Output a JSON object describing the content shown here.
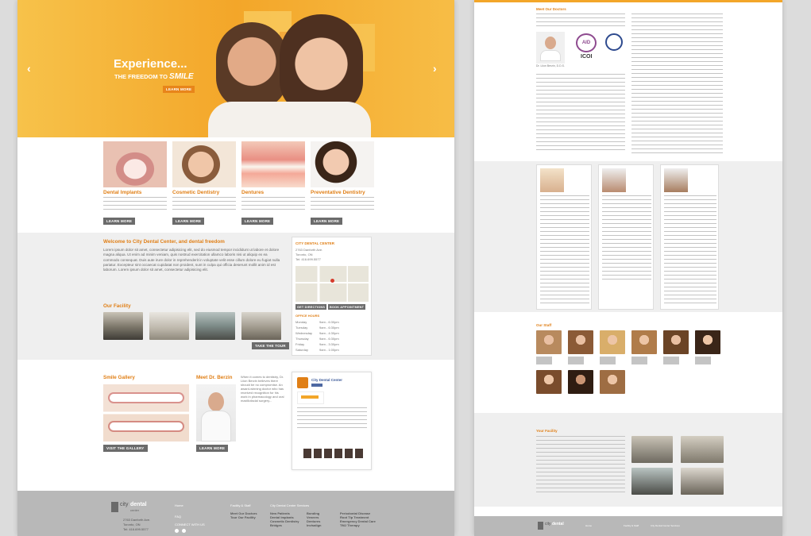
{
  "hero": {
    "title": "Experience...",
    "subtitle_prefix": "THE FREEDOM TO",
    "subtitle_emphasis": "SMILE",
    "button": "LEARN MORE"
  },
  "services": [
    {
      "title": "Dental Implants",
      "button": "LEARN MORE"
    },
    {
      "title": "Cosmetic Dentistry",
      "button": "LEARN MORE"
    },
    {
      "title": "Dentures",
      "button": "LEARN MORE"
    },
    {
      "title": "Preventative Dentistry",
      "button": "LEARN MORE"
    }
  ],
  "welcome": {
    "title": "Welcome to City Dental Center, and dental freedom",
    "body": "Lorem ipsum dolor sit amet, consectetur adipisicing elit, sed do eiusmod tempor incididunt ut labore et dolore magna aliqua. Ut enim ad minim veniam, quis nostrud exercitation ullamco laboris nisi ut aliquip ex ea commodo consequat. Duis aute irure dolor in reprehenderit in voluptate velit esse cillum dolore eu fugiat nulla pariatur. Excepteur sint occaecat cupidatat non proident, sunt in culpa qui officia deserunt mollit anim id est laborum. Lorem ipsum dolor sit amet, consectetur adipisicing elit."
  },
  "facility": {
    "title": "Our Facility",
    "button": "TAKE THE TOUR"
  },
  "contact": {
    "name": "CITY DENTAL CENTER",
    "address1": "2763 Danforth Ave.",
    "address2": "Toronto, ON",
    "phone": "Tel: 416.699.5577",
    "directions_button": "GET DIRECTIONS",
    "appointment_button": "BOOK APPOINTMENT",
    "hours_title": "OFFICE HOURS",
    "hours": [
      {
        "day": "Monday",
        "time": "9am - 6:30pm"
      },
      {
        "day": "Tuesday",
        "time": "9am - 6:30pm"
      },
      {
        "day": "Wednesday",
        "time": "9am - 4:30pm"
      },
      {
        "day": "Thursday",
        "time": "9am - 6:30pm"
      },
      {
        "day": "Friday",
        "time": "9am - 3:30pm"
      },
      {
        "day": "Saturday",
        "time": "9am - 1:00pm"
      }
    ]
  },
  "gallery": {
    "title": "Smile Gallery",
    "button": "VISIT THE GALLERY"
  },
  "meet": {
    "title": "Meet Dr. Berzin",
    "body": "When it comes to dentistry, Dr. Liion Berzin believes there should be no compromise. An award-winning doctor who has received recognition for his work in pharmacology and oral maxillofacial surgery...",
    "button": "LEARN MORE"
  },
  "social": {
    "name": "City Dental Center"
  },
  "footer": {
    "logo_city": "city",
    "logo_dental": "dental",
    "logo_center": "center",
    "addr1": "2763 Danforth Ave.",
    "addr2": "Toronto, ON",
    "phone": "Tel: 416.699.5577",
    "col1": [
      "Home",
      "FAQ",
      "CONNECT WITH US"
    ],
    "col2_title": "Facility & Staff",
    "col2": [
      "Meet Our Doctors",
      "Tour Our Facility"
    ],
    "col3_title": "City Dental Center Services",
    "col3a": [
      "New Patients",
      "Dental Implants",
      "Cosmetic Dentistry",
      "Bridges"
    ],
    "col3b": [
      "Bonding",
      "Veneers",
      "Dentures",
      "Invisalign"
    ],
    "col3c": [
      "Periodontal Disease",
      "Root Tip Treatment",
      "Emergency Dental Care",
      "TMJ Therapy"
    ]
  },
  "page2": {
    "meet_title": "Meet Our Doctors",
    "doctor_caption": "Dr. Liion Berzin, D.D.S.",
    "badges": [
      "AID",
      "ICOI"
    ],
    "staff_title": "Our Staff",
    "facility_title": "Your Facility"
  },
  "colors": {
    "accent": "#e07f16",
    "hero_bg": "#f5b330",
    "footer_bg": "#b8b8b8"
  }
}
